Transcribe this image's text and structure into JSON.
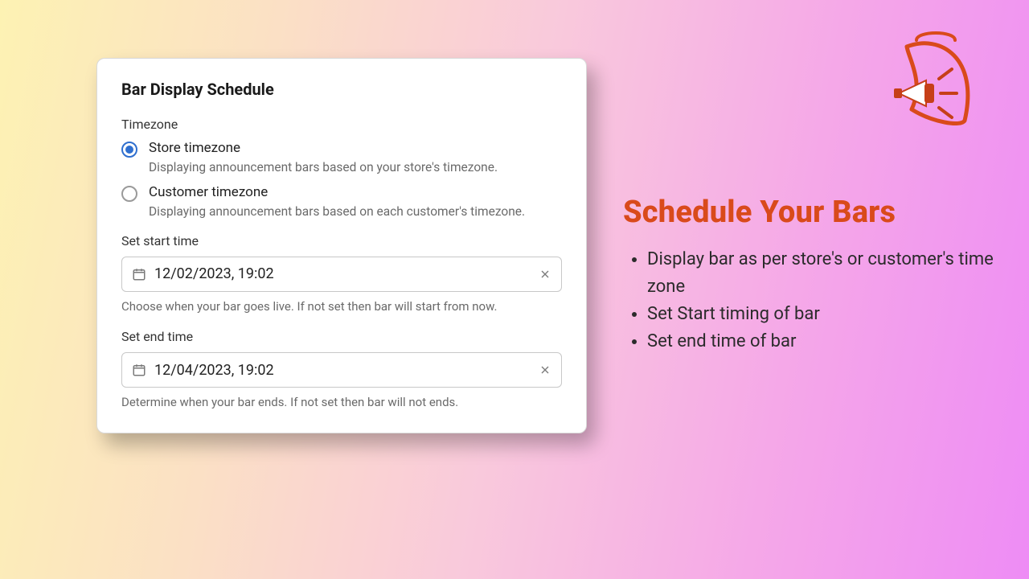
{
  "card": {
    "title": "Bar Display Schedule",
    "timezone_label": "Timezone",
    "options": [
      {
        "label": "Store timezone",
        "desc": "Displaying announcement bars based on your store's timezone.",
        "checked": true
      },
      {
        "label": "Customer timezone",
        "desc": "Displaying announcement bars based on each customer's timezone.",
        "checked": false
      }
    ],
    "start": {
      "label": "Set start time",
      "value": "12/02/2023, 19:02",
      "helper": "Choose when your bar goes live. If not set then bar will start from now."
    },
    "end": {
      "label": "Set end time",
      "value": "12/04/2023, 19:02",
      "helper": "Determine when your bar ends. If not set then bar will not ends."
    }
  },
  "promo": {
    "heading": "Schedule Your Bars",
    "bullets": [
      "Display bar as per store's or customer's time zone",
      "Set Start timing of bar",
      "Set end time of bar"
    ]
  },
  "colors": {
    "accent": "#d94a1b",
    "radio": "#2f6fcf"
  }
}
